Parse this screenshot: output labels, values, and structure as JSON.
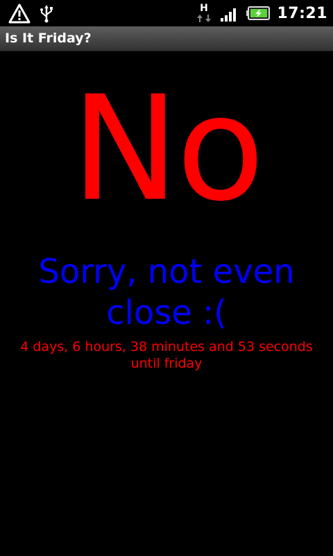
{
  "status_bar": {
    "left_icons": [
      "warning-icon",
      "usb-icon"
    ],
    "right_icons": [
      "network-h-icon",
      "signal-icon",
      "battery-charging-icon"
    ],
    "network_type": "H",
    "time": "17:21"
  },
  "app": {
    "title": "Is It Friday?"
  },
  "main": {
    "answer": "No",
    "message": "Sorry, not even close :(",
    "countdown": "4 days, 6 hours, 38 minutes and 53 seconds until friday"
  },
  "colors": {
    "answer": "#ff0000",
    "message": "#0000ff",
    "countdown": "#ff0000",
    "background": "#000000"
  }
}
